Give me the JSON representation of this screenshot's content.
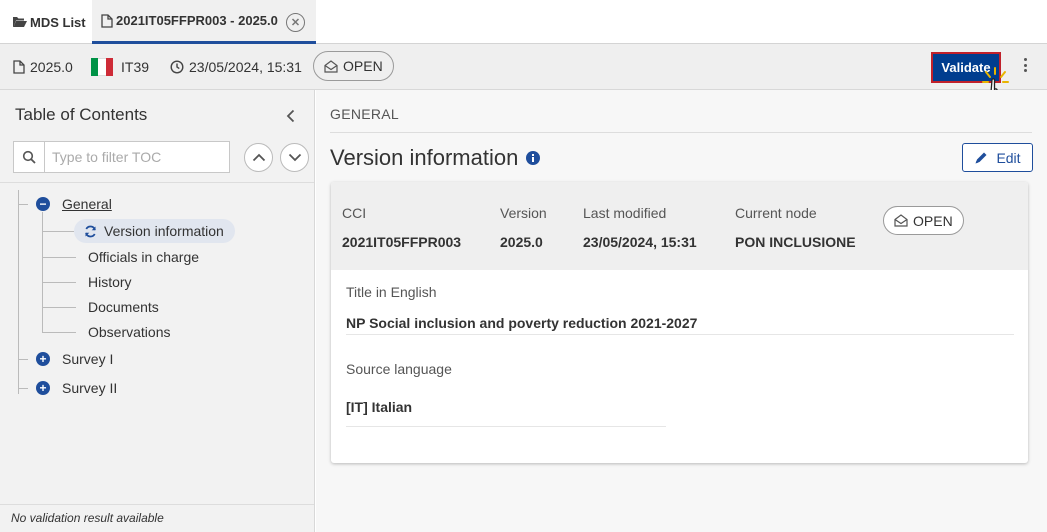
{
  "tabs": {
    "mds_list": "MDS List",
    "active": "2021IT05FFPR003 - 2025.0"
  },
  "infobar": {
    "version": "2025.0",
    "country": "IT39",
    "date": "23/05/2024, 15:31",
    "status": "OPEN",
    "validate_label": "Validate"
  },
  "toc": {
    "title": "Table of Contents",
    "search_placeholder": "Type to filter TOC",
    "general": "General",
    "children": {
      "version_information": "Version information",
      "officials": "Officials in charge",
      "history": "History",
      "documents": "Documents",
      "observations": "Observations"
    },
    "survey1": "Survey I",
    "survey2": "Survey II",
    "status_footer": "No validation result available"
  },
  "main": {
    "section": "GENERAL",
    "title": "Version information",
    "edit_label": "Edit",
    "header": {
      "cci_label": "CCI",
      "cci_value": "2021IT05FFPR003",
      "version_label": "Version",
      "version_value": "2025.0",
      "modified_label": "Last modified",
      "modified_value": "23/05/2024, 15:31",
      "node_label": "Current node",
      "node_value": "PON INCLUSIONE",
      "status": "OPEN"
    },
    "title_en_label": "Title in English",
    "title_en_value": "NP Social inclusion and poverty reduction 2021-2027",
    "source_lang_label": "Source language",
    "source_lang_value": "[IT] Italian"
  },
  "colors": {
    "primary": "#1f4e9c",
    "validate_bg": "#003d8f",
    "validate_border": "#c0202a",
    "flag_green": "#009246",
    "flag_white": "#ffffff",
    "flag_red": "#ce2b37"
  },
  "icons": [
    "folder-open-icon",
    "file-icon",
    "close-circle-icon",
    "clock-icon",
    "envelope-open-icon",
    "more-vertical-icon",
    "pointer-cursor-icon",
    "chevron-left-icon",
    "search-icon",
    "chevron-up-icon",
    "chevron-down-icon",
    "minus-circle-icon",
    "plus-circle-icon",
    "refresh-icon",
    "info-icon",
    "pencil-icon"
  ]
}
